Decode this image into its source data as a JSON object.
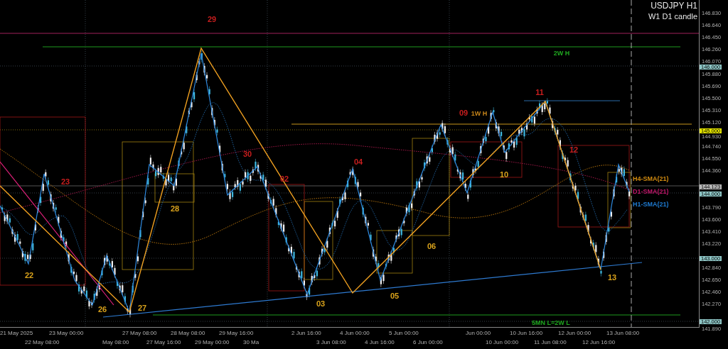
{
  "chart": {
    "symbol": "USDJPY H1",
    "subtitle": "W1 D1 candle",
    "wave_labels": [
      {
        "text": "29",
        "color": "#c81e1e"
      },
      {
        "text": "23",
        "color": "#c81e1e"
      },
      {
        "text": "30",
        "color": "#c81e1e"
      },
      {
        "text": "02",
        "color": "#c81e1e"
      },
      {
        "text": "04",
        "color": "#c81e1e"
      },
      {
        "text": "09",
        "color": "#c81e1e"
      },
      {
        "text": "11",
        "color": "#c81e1e"
      },
      {
        "text": "12",
        "color": "#c81e1e"
      },
      {
        "text": "22",
        "color": "#d9a21b"
      },
      {
        "text": "28",
        "color": "#d9a21b"
      },
      {
        "text": "26",
        "color": "#d9a21b"
      },
      {
        "text": "27",
        "color": "#d9a21b"
      },
      {
        "text": "03",
        "color": "#d9a21b"
      },
      {
        "text": "05",
        "color": "#d9a21b"
      },
      {
        "text": "06",
        "color": "#d9a21b"
      },
      {
        "text": "10",
        "color": "#d9a21b"
      },
      {
        "text": "13",
        "color": "#d9a21b"
      }
    ],
    "level_labels": [
      {
        "text": "2W H",
        "color": "#1fa81f"
      },
      {
        "text": "1W H",
        "color": "#c8861a"
      },
      {
        "text": "5MN L=2W L",
        "color": "#1fa81f"
      }
    ],
    "sma_labels": [
      {
        "text": "H4-SMA(21)",
        "color": "#d08a10"
      },
      {
        "text": "D1-SMA(21)",
        "color": "#c0176a"
      },
      {
        "text": "H1-SMA(21)",
        "color": "#1e7ad0"
      }
    ]
  },
  "price_axis": {
    "ticks": [
      "146.830",
      "146.640",
      "146.450",
      "146.260",
      "146.070",
      "145.880",
      "145.690",
      "145.500",
      "145.310",
      "145.120",
      "144.930",
      "144.740",
      "144.550",
      "144.360",
      "143.790",
      "143.600",
      "143.410",
      "143.220",
      "142.840",
      "142.650",
      "142.460",
      "142.270",
      "141.890"
    ],
    "markers": [
      {
        "text": "146.000",
        "kind": "level"
      },
      {
        "text": "145.000",
        "kind": "alert"
      },
      {
        "text": "144.123",
        "kind": "bid"
      },
      {
        "text": "144.000",
        "kind": "level"
      },
      {
        "text": "143.000",
        "kind": "level"
      },
      {
        "text": "142.000",
        "kind": "level"
      }
    ]
  },
  "time_axis": {
    "ticks": [
      "21 May 2025",
      "22 May 08:00",
      "23 May 00:00",
      "May 08:00",
      "27 May 08:00",
      "27 May 16:00",
      "28 May 08:00",
      "29 May 00:00",
      "29 May 16:00",
      "30 Ma",
      "2 Jun 16:00",
      "3 Jun 08:00",
      "4 Jun 00:00",
      "4 Jun 16:00",
      "5 Jun 00:00",
      "6 Jun 00:00",
      "Jun 00:00",
      "10 Jun 00:00",
      "10 Jun 16:00",
      "11 Jun 08:00",
      "12 Jun 00:00",
      "12 Jun 16:00",
      "13 Jun 08:00"
    ]
  }
}
